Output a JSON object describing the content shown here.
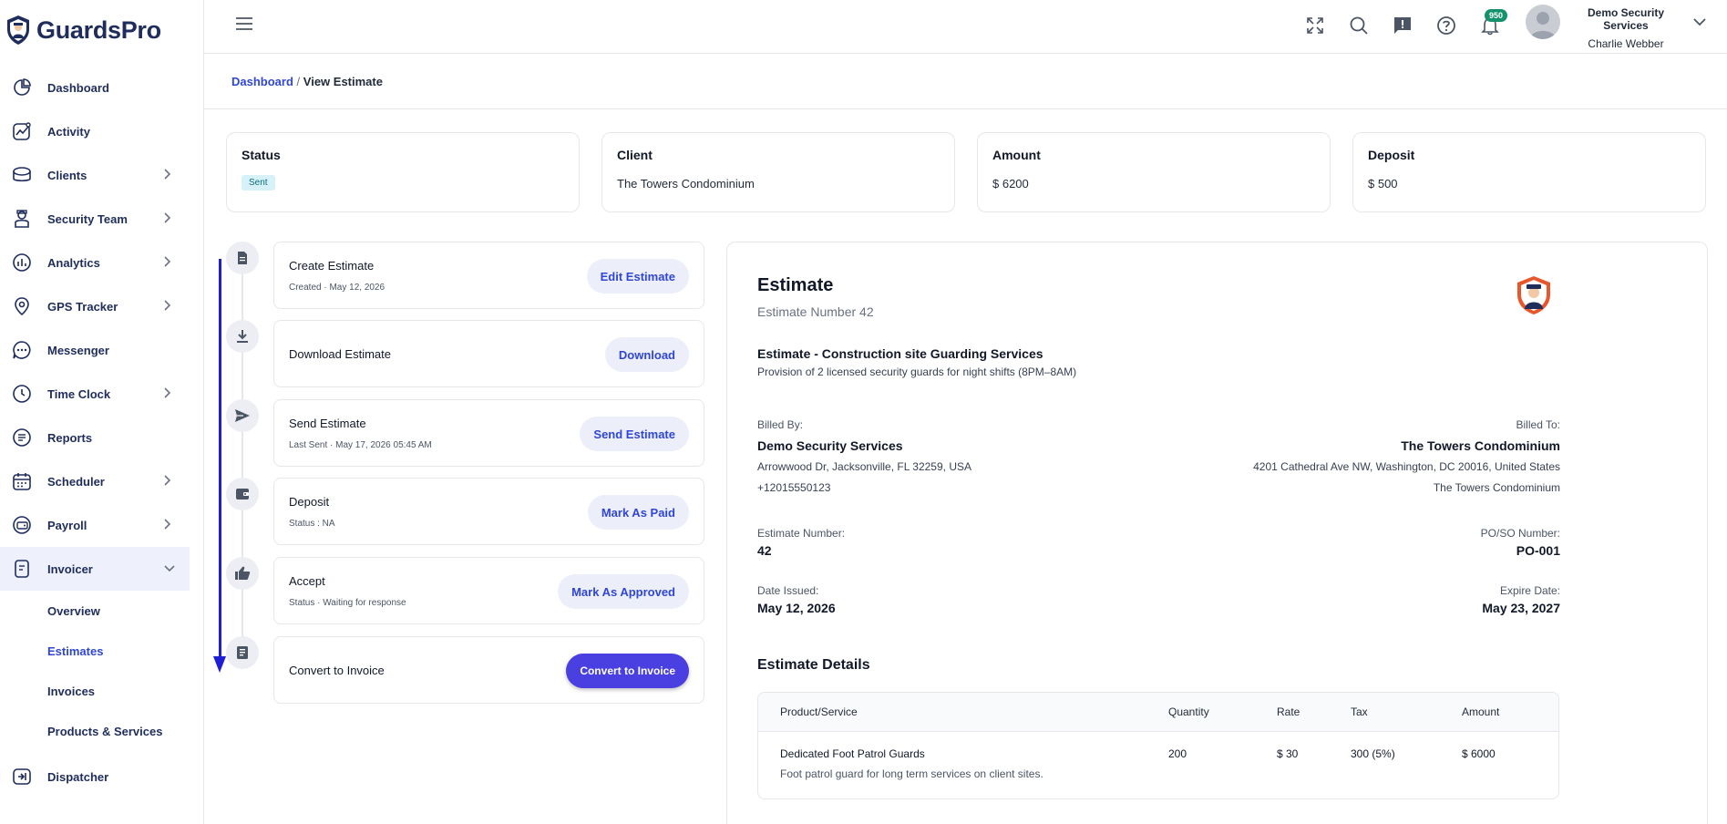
{
  "app": {
    "name": "GuardsPro"
  },
  "sidebar": {
    "items": [
      {
        "label": "Dashboard",
        "icon": "dashboard-icon"
      },
      {
        "label": "Activity",
        "icon": "activity-icon"
      },
      {
        "label": "Clients",
        "icon": "clients-icon"
      },
      {
        "label": "Security Team",
        "icon": "security-team-icon"
      },
      {
        "label": "Analytics",
        "icon": "analytics-icon"
      },
      {
        "label": "GPS Tracker",
        "icon": "gps-pin-icon"
      },
      {
        "label": "Messenger",
        "icon": "chat-icon"
      },
      {
        "label": "Time Clock",
        "icon": "clock-icon"
      },
      {
        "label": "Reports",
        "icon": "reports-icon"
      },
      {
        "label": "Scheduler",
        "icon": "calendar-icon"
      },
      {
        "label": "Payroll",
        "icon": "wallet-icon"
      },
      {
        "label": "Invoicer",
        "icon": "invoice-icon"
      },
      {
        "label": "Dispatcher",
        "icon": "dispatch-icon"
      }
    ],
    "invoicer_sub": [
      "Overview",
      "Estimates",
      "Invoices",
      "Products & Services"
    ]
  },
  "header": {
    "notification_count": "950",
    "company": "Demo Security Services",
    "user": "Charlie Webber"
  },
  "breadcrumb": {
    "root": "Dashboard",
    "separator": "/",
    "current": "View Estimate"
  },
  "summary": {
    "status_title": "Status",
    "status_value": "Sent",
    "client_title": "Client",
    "client_value": "The Towers Condominium",
    "amount_title": "Amount",
    "amount_value": "$ 6200",
    "deposit_title": "Deposit",
    "deposit_value": "$ 500"
  },
  "steps": [
    {
      "title": "Create Estimate",
      "sub": "Created · May 12, 2026",
      "button": "Edit Estimate",
      "icon": "document-icon"
    },
    {
      "title": "Download Estimate",
      "sub": "",
      "button": "Download",
      "icon": "download-icon"
    },
    {
      "title": "Send Estimate",
      "sub": "Last Sent · May 17, 2026 05:45 AM",
      "button": "Send Estimate",
      "icon": "send-icon"
    },
    {
      "title": "Deposit",
      "sub": "Status : NA",
      "button": "Mark As Paid",
      "icon": "wallet-icon"
    },
    {
      "title": "Accept",
      "sub": "Status · Waiting for response",
      "button": "Mark As Approved",
      "icon": "thumbs-up-icon"
    },
    {
      "title": "Convert to Invoice",
      "sub": "",
      "button": "Convert to Invoice",
      "icon": "invoice-icon"
    }
  ],
  "estimate": {
    "title": "Estimate",
    "number_line": "Estimate Number 42",
    "heading": "Estimate - Construction site Guarding Services",
    "description": "Provision of 2 licensed security guards for night shifts (8PM–8AM)",
    "billed_by_label": "Billed By:",
    "billed_by_name": "Demo Security Services",
    "billed_by_address": "Arrowwood Dr, Jacksonville, FL 32259, USA",
    "billed_by_phone": "+12015550123",
    "billed_to_label": "Billed To:",
    "billed_to_name": "The Towers Condominium",
    "billed_to_address": "4201 Cathedral Ave NW, Washington, DC 20016, United States",
    "billed_to_extra": "The Towers Condominium",
    "number_label": "Estimate Number:",
    "number_value": "42",
    "po_label": "PO/SO Number:",
    "po_value": "PO-001",
    "issued_label": "Date Issued:",
    "issued_value": "May 12, 2026",
    "expire_label": "Expire Date:",
    "expire_value": "May 23, 2027",
    "details_title": "Estimate Details",
    "table": {
      "headers": [
        "Product/Service",
        "Quantity",
        "Rate",
        "Tax",
        "Amount"
      ],
      "rows": [
        {
          "product": "Dedicated Foot Patrol Guards",
          "quantity": "200",
          "rate": "$ 30",
          "tax": "300 (5%)",
          "amount": "$ 6000",
          "note": "Foot patrol guard for long term services on client sites."
        }
      ]
    }
  },
  "colors": {
    "primary": "#2f46d6",
    "primary_button": "#4a3fe0",
    "nav_text": "#1f2d5c",
    "badge": "#15926b",
    "status_pill_bg": "#d6f1f7"
  }
}
